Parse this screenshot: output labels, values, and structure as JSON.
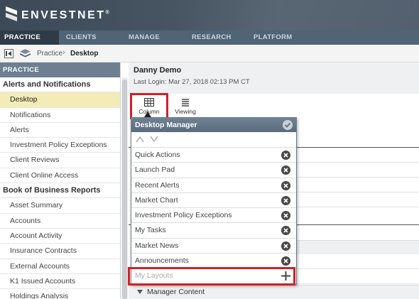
{
  "brand": {
    "name": "ENVESTNET",
    "trademark": "®"
  },
  "topnav": [
    "PRACTICE",
    "CLIENTS",
    "MANAGE",
    "RESEARCH",
    "PLATFORM"
  ],
  "breadcrumb": {
    "items": [
      "Practice",
      "Desktop"
    ]
  },
  "sidebar": {
    "header": "PRACTICE",
    "rows": [
      {
        "label": "Alerts and Notifications",
        "kind": "section"
      },
      {
        "label": "Desktop",
        "kind": "selected"
      },
      {
        "label": "Notifications",
        "kind": "item"
      },
      {
        "label": "Alerts",
        "kind": "item"
      },
      {
        "label": "Investment Policy Exceptions",
        "kind": "item"
      },
      {
        "label": "Client Reviews",
        "kind": "item"
      },
      {
        "label": "Client Online Access",
        "kind": "item"
      },
      {
        "label": "Book of Business Reports",
        "kind": "section"
      },
      {
        "label": "Asset Summary",
        "kind": "item"
      },
      {
        "label": "Accounts",
        "kind": "item"
      },
      {
        "label": "Account Activity",
        "kind": "item"
      },
      {
        "label": "Insurance Contracts",
        "kind": "item"
      },
      {
        "label": "External Accounts",
        "kind": "item"
      },
      {
        "label": "K1 Issued Accounts",
        "kind": "item"
      },
      {
        "label": "Holdings Analysis",
        "kind": "item"
      }
    ]
  },
  "user": {
    "name": "Danny Demo",
    "last_login": "Last Login: Mar 27, 2018 02:13 PM CT"
  },
  "toolbar": {
    "column_label": "Column",
    "viewing_label": "Viewing"
  },
  "desktop_manager": {
    "title": "Desktop Manager",
    "items": [
      "Quick Actions",
      "Launch Pad",
      "Recent Alerts",
      "Market Chart",
      "Investment Policy Exceptions",
      "My Tasks",
      "Market News",
      "Announcements"
    ],
    "layouts_label": "My Layouts"
  },
  "manager_content": "Manager Content",
  "colors": {
    "highlight": "#d21f26",
    "selected_row": "#f3ecb6",
    "nav_dark": "#2f3c48"
  }
}
